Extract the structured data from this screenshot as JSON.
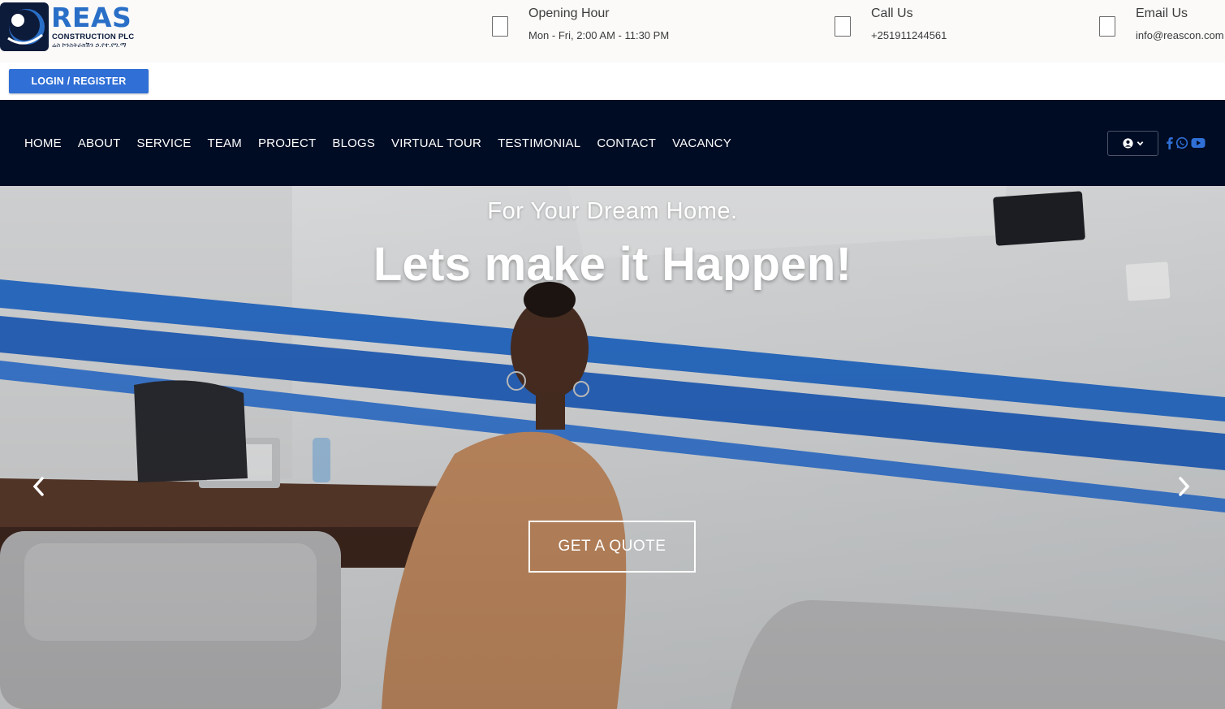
{
  "brand": {
    "name": "REAS",
    "subtitle": "CONSTRUCTION PLC",
    "amharic": "ሬስ ኮንስትራክሽን ኃ.የተ.የግ.ማ",
    "colors": {
      "primary": "#2a6fc7",
      "navy": "#000c24",
      "button": "#2f6fd6"
    }
  },
  "info": {
    "hours": {
      "title": "Opening Hour",
      "value": "Mon - Fri, 2:00 AM - 11:30 PM"
    },
    "call": {
      "title": "Call Us",
      "value": "+251911244561"
    },
    "email": {
      "title": "Email Us",
      "value": "info@reascon.com"
    }
  },
  "auth": {
    "login_label": "LOGIN / REGISTER"
  },
  "nav": {
    "items": [
      "HOME",
      "ABOUT",
      "SERVICE",
      "TEAM",
      "PROJECT",
      "BLOGS",
      "VIRTUAL TOUR",
      "TESTIMONIAL",
      "CONTACT",
      "VACANCY"
    ],
    "user_icon": "user-circle-icon",
    "social_icons": [
      "facebook-icon",
      "whatsapp-icon",
      "youtube-icon"
    ]
  },
  "hero": {
    "subtitle": "For Your Dream Home.",
    "title": "Lets make it Happen!",
    "cta": "GET A QUOTE",
    "prev_icon": "chevron-left-icon",
    "next_icon": "chevron-right-icon"
  }
}
